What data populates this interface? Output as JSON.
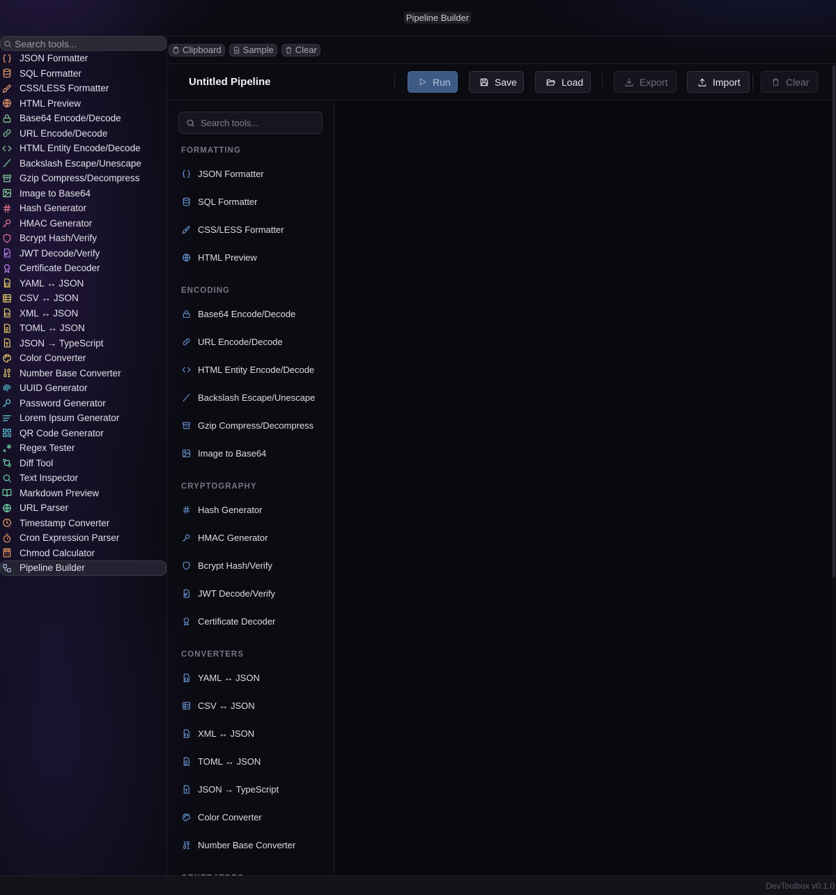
{
  "window": {
    "title": "Pipeline Builder"
  },
  "sidebar": {
    "search_placeholder": "Search tools...",
    "items": [
      {
        "label": "JSON Formatter",
        "icon": "braces-icon",
        "color": "#f0a070"
      },
      {
        "label": "SQL Formatter",
        "icon": "database-icon",
        "color": "#f0a070"
      },
      {
        "label": "CSS/LESS Formatter",
        "icon": "paintbrush-icon",
        "color": "#f0a070"
      },
      {
        "label": "HTML Preview",
        "icon": "globe-icon",
        "color": "#f0a070"
      },
      {
        "label": "Base64 Encode/Decode",
        "icon": "lock-icon",
        "color": "#8ad8a0"
      },
      {
        "label": "URL Encode/Decode",
        "icon": "link-icon",
        "color": "#8ad8a0"
      },
      {
        "label": "HTML Entity Encode/Decode",
        "icon": "code-icon",
        "color": "#8ad8a0"
      },
      {
        "label": "Backslash Escape/Unescape",
        "icon": "slash-icon",
        "color": "#8ad8a0"
      },
      {
        "label": "Gzip Compress/Decompress",
        "icon": "archive-icon",
        "color": "#8ad8a0"
      },
      {
        "label": "Image to Base64",
        "icon": "image-icon",
        "color": "#8ad8a0"
      },
      {
        "label": "Hash Generator",
        "icon": "hash-icon",
        "color": "#f07898"
      },
      {
        "label": "HMAC Generator",
        "icon": "key-icon",
        "color": "#f07898"
      },
      {
        "label": "Bcrypt Hash/Verify",
        "icon": "shield-icon",
        "color": "#f07898"
      },
      {
        "label": "JWT Decode/Verify",
        "icon": "file-key-icon",
        "color": "#c080f0"
      },
      {
        "label": "Certificate Decoder",
        "icon": "award-icon",
        "color": "#c080f0"
      },
      {
        "label": "YAML ↔ JSON",
        "icon": "file-json-icon",
        "color": "#f0d070"
      },
      {
        "label": "CSV ↔ JSON",
        "icon": "table-icon",
        "color": "#f0d070"
      },
      {
        "label": "XML ↔ JSON",
        "icon": "file-code-icon",
        "color": "#f0d070"
      },
      {
        "label": "TOML ↔ JSON",
        "icon": "file-text-icon",
        "color": "#f0d070"
      },
      {
        "label": "JSON → TypeScript",
        "icon": "file-type-icon",
        "color": "#f0d070"
      },
      {
        "label": "Color Converter",
        "icon": "palette-icon",
        "color": "#f0d070"
      },
      {
        "label": "Number Base Converter",
        "icon": "binary-icon",
        "color": "#f0d070"
      },
      {
        "label": "UUID Generator",
        "icon": "fingerprint-icon",
        "color": "#60d0e0"
      },
      {
        "label": "Password Generator",
        "icon": "key-icon",
        "color": "#60d0e0"
      },
      {
        "label": "Lorem Ipsum Generator",
        "icon": "text-lines-icon",
        "color": "#60d0e0"
      },
      {
        "label": "QR Code Generator",
        "icon": "qr-code-icon",
        "color": "#60d0e0"
      },
      {
        "label": "Regex Tester",
        "icon": "regex-icon",
        "color": "#70d8a8"
      },
      {
        "label": "Diff Tool",
        "icon": "git-compare-icon",
        "color": "#70d8a8"
      },
      {
        "label": "Text Inspector",
        "icon": "search-icon",
        "color": "#70d8a8"
      },
      {
        "label": "Markdown Preview",
        "icon": "book-open-icon",
        "color": "#70d8a8"
      },
      {
        "label": "URL Parser",
        "icon": "globe-icon",
        "color": "#70d8a8"
      },
      {
        "label": "Timestamp Converter",
        "icon": "clock-icon",
        "color": "#f0a060"
      },
      {
        "label": "Cron Expression Parser",
        "icon": "timer-icon",
        "color": "#f0a060"
      },
      {
        "label": "Chmod Calculator",
        "icon": "calculator-icon",
        "color": "#f0a060"
      },
      {
        "label": "Pipeline Builder",
        "icon": "workflow-icon",
        "color": "#a8b8e0",
        "active": true
      }
    ]
  },
  "toolbar": {
    "clipboard_label": "Clipboard",
    "sample_label": "Sample",
    "clear_label": "Clear"
  },
  "pipeline": {
    "name": "Untitled Pipeline",
    "run_label": "Run",
    "save_label": "Save",
    "load_label": "Load",
    "export_label": "Export",
    "import_label": "Import",
    "clear_label": "Clear"
  },
  "palette": {
    "search_placeholder": "Search tools...",
    "accent": "#6a9ad8",
    "categories": [
      {
        "name": "FORMATTING",
        "items": [
          {
            "label": "JSON Formatter",
            "icon": "braces-icon"
          },
          {
            "label": "SQL Formatter",
            "icon": "database-icon"
          },
          {
            "label": "CSS/LESS Formatter",
            "icon": "paintbrush-icon"
          },
          {
            "label": "HTML Preview",
            "icon": "globe-icon"
          }
        ]
      },
      {
        "name": "ENCODING",
        "items": [
          {
            "label": "Base64 Encode/Decode",
            "icon": "lock-icon"
          },
          {
            "label": "URL Encode/Decode",
            "icon": "link-icon"
          },
          {
            "label": "HTML Entity Encode/Decode",
            "icon": "code-icon"
          },
          {
            "label": "Backslash Escape/Unescape",
            "icon": "slash-icon"
          },
          {
            "label": "Gzip Compress/Decompress",
            "icon": "archive-icon"
          },
          {
            "label": "Image to Base64",
            "icon": "image-icon"
          }
        ]
      },
      {
        "name": "CRYPTOGRAPHY",
        "items": [
          {
            "label": "Hash Generator",
            "icon": "hash-icon"
          },
          {
            "label": "HMAC Generator",
            "icon": "key-icon"
          },
          {
            "label": "Bcrypt Hash/Verify",
            "icon": "shield-icon"
          },
          {
            "label": "JWT Decode/Verify",
            "icon": "file-key-icon"
          },
          {
            "label": "Certificate Decoder",
            "icon": "award-icon"
          }
        ]
      },
      {
        "name": "CONVERTERS",
        "items": [
          {
            "label": "YAML ↔ JSON",
            "icon": "file-json-icon"
          },
          {
            "label": "CSV ↔ JSON",
            "icon": "table-icon"
          },
          {
            "label": "XML ↔ JSON",
            "icon": "file-code-icon"
          },
          {
            "label": "TOML ↔ JSON",
            "icon": "file-text-icon"
          },
          {
            "label": "JSON → TypeScript",
            "icon": "file-type-icon"
          },
          {
            "label": "Color Converter",
            "icon": "palette-icon"
          },
          {
            "label": "Number Base Converter",
            "icon": "binary-icon"
          }
        ]
      },
      {
        "name": "GENERATORS",
        "items": []
      }
    ]
  },
  "status": {
    "version": "DevToolbox v0.1.0"
  }
}
